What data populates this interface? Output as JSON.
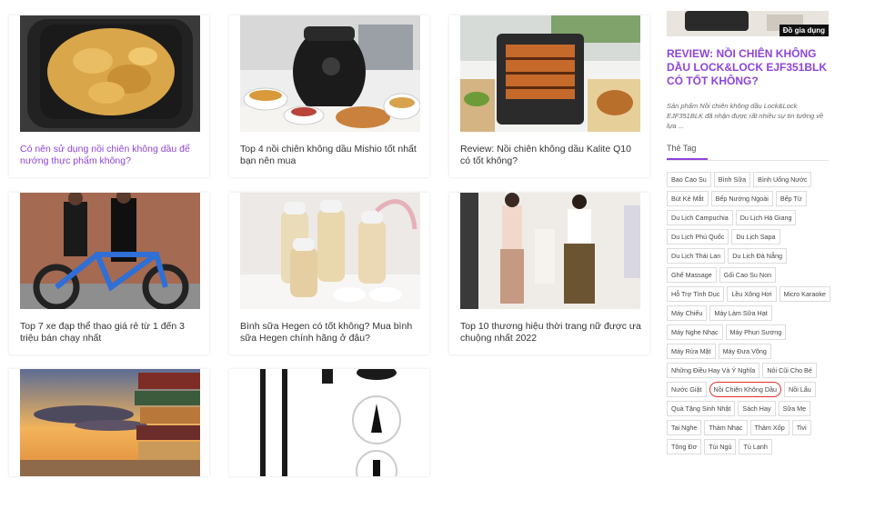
{
  "posts": [
    {
      "title": "Có nên sử dụng nồi chiên không dầu để nướng thực phẩm không?",
      "visited": true
    },
    {
      "title": "Top 4 nồi chiên không dầu Mishio tốt nhất bạn nên mua",
      "visited": false
    },
    {
      "title": "Review: Nồi chiên không dầu Kalite Q10 có tốt không?",
      "visited": false
    },
    {
      "title": "Top 7 xe đạp thể thao giá rẻ từ 1 đến 3 triệu bán chạy nhất",
      "visited": false
    },
    {
      "title": "Bình sữa Hegen có tốt không? Mua bình sữa Hegen chính hãng ở đâu?",
      "visited": false
    },
    {
      "title": "Top 10 thương hiệu thời trang nữ được ưa chuộng nhất 2022",
      "visited": false
    },
    {
      "title": "",
      "visited": false
    },
    {
      "title": "",
      "visited": false
    }
  ],
  "sidebar": {
    "badge": "Đồ gia dụng",
    "title": "REVIEW: NỒI CHIÊN KHÔNG DẦU LOCK&LOCK EJF351BLK CÓ TỐT KHÔNG?",
    "desc": "Sản phẩm Nồi chiên không dầu Lock&Lock EJF351BLK đã nhận được rất nhiều sự tin tưởng về lựa ...",
    "tag_heading": "Thẻ Tag",
    "tags": [
      "Bao Cao Su",
      "Bình Sữa",
      "Bình Uống Nước",
      "Bút Kẻ Mắt",
      "Bếp Nướng Ngoài",
      "Bếp Từ",
      "Du Lịch Campuchia",
      "Du Lịch Hà Giang",
      "Du Lịch Phú Quốc",
      "Du Lịch Sapa",
      "Du Lịch Thái Lan",
      "Du Lịch Đà Nẵng",
      "Ghế Massage",
      "Gối Cao Su Non",
      "Hỗ Trợ Tình Dục",
      "Lều Xông Hơi",
      "Micro Karaoke",
      "Máy Chiếu",
      "Máy Làm Sữa Hạt",
      "Máy Nghe Nhạc",
      "Máy Phun Sương",
      "Máy Rửa Mặt",
      "Máy Đưa Võng",
      "Những Điều Hay Và Ý Nghĩa",
      "Nôi Cũi Cho Bé",
      "Nước Giặt",
      "Nồi Chiên Không Dầu",
      "Nồi Lẩu",
      "Quà Tặng Sinh Nhật",
      "Sách Hay",
      "Sữa Mẹ",
      "Tai Nghe",
      "Thảm Nhạc",
      "Thảm Xốp",
      "Tivi",
      "Tông Đơ",
      "Túi Ngủ",
      "Tủ Lạnh"
    ],
    "circled_tag_index": 26
  },
  "colors": {
    "accent": "#8e44d8",
    "highlight_circle": "#e0322d"
  }
}
